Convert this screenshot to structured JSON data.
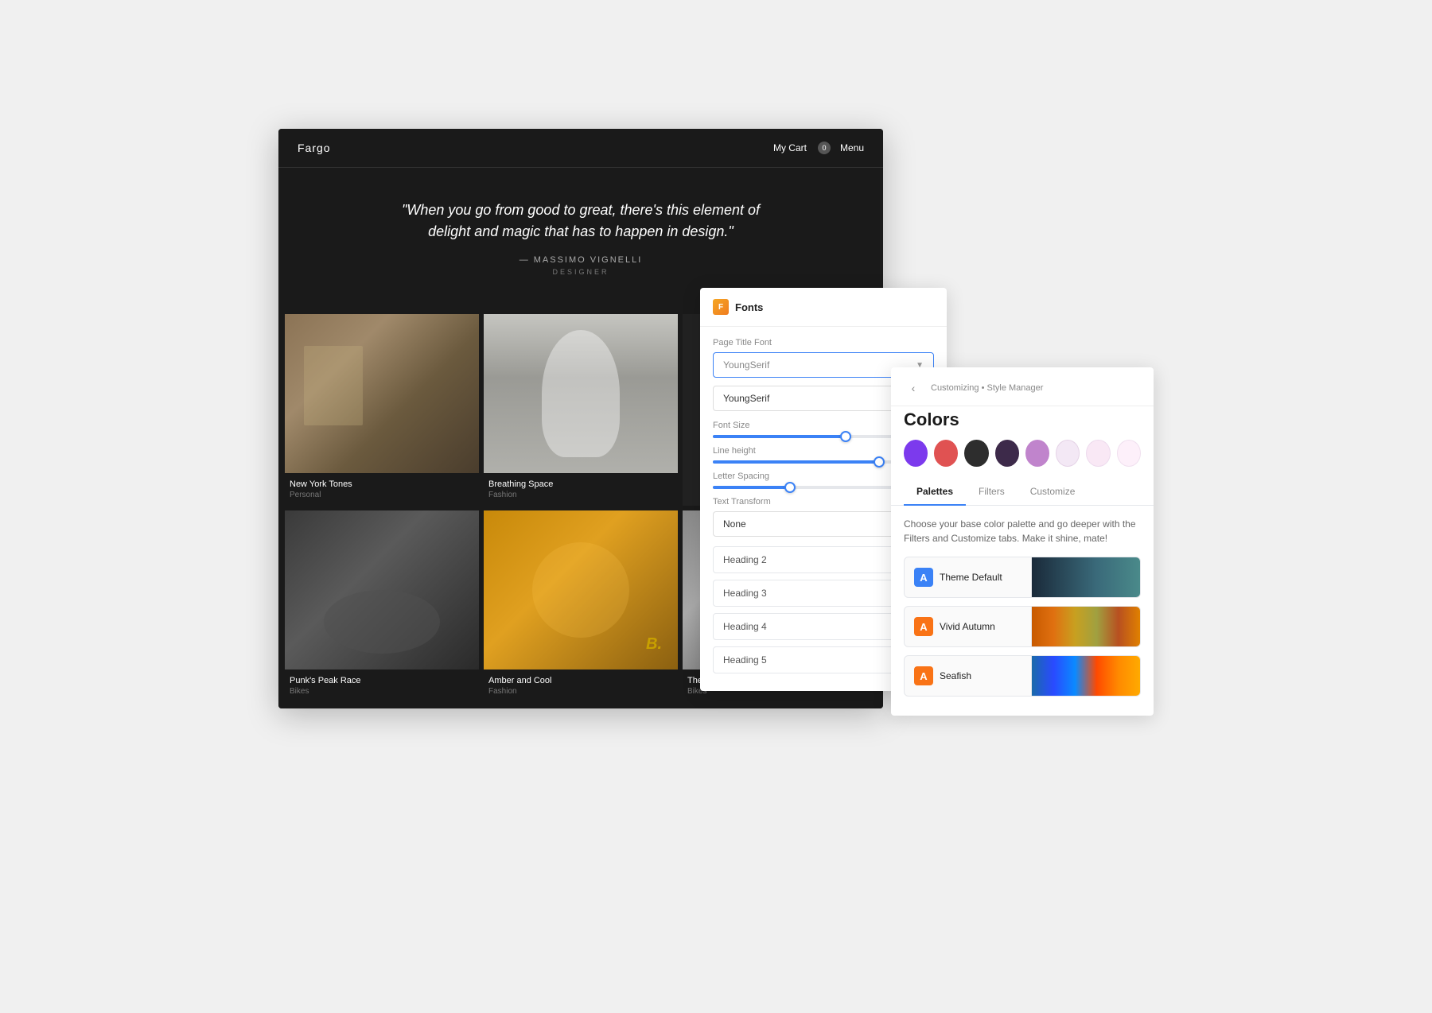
{
  "website": {
    "logo": "Fargo",
    "nav": {
      "cart_label": "My Cart",
      "cart_count": "0",
      "menu_label": "Menu"
    },
    "hero": {
      "quote": "\"When you go from good to great, there's this element of delight and magic that has to happen in design.\"",
      "author": "— MASSIMO VIGNELLI",
      "author_title": "DESIGNER"
    },
    "grid_items": [
      {
        "title": "New York Tones",
        "category": "Personal"
      },
      {
        "title": "Breathing Space",
        "category": "Fashion"
      },
      {
        "title": "Punk's Peak Race",
        "category": "Bikes"
      },
      {
        "title": "Amber and Cool",
        "category": "Fashion"
      },
      {
        "title": "The Bike Shed",
        "category": "Bikes"
      }
    ]
  },
  "fonts_panel": {
    "title": "Fonts",
    "icon_label": "F",
    "page_title_font_label": "Page Title Font",
    "page_title_font_value": "YoungSerif",
    "body_font_value": "YoungSerif",
    "font_size_label": "Font Size",
    "font_size_fill_pct": "60",
    "font_size_thumb_pct": "60",
    "line_height_label": "Line height",
    "line_height_fill_pct": "75",
    "line_height_thumb_pct": "75",
    "letter_spacing_label": "Letter Spacing",
    "letter_spacing_fill_pct": "35",
    "letter_spacing_thumb_pct": "35",
    "text_transform_label": "Text Transform",
    "text_transform_value": "None",
    "heading2_label": "Heading 2",
    "heading3_label": "Heading 3",
    "heading4_label": "Heading 4",
    "heading5_label": "Heading 5"
  },
  "colors_panel": {
    "breadcrumb": "Customizing • Style Manager",
    "title": "Colors",
    "back_label": "‹",
    "tabs": [
      "Palettes",
      "Filters",
      "Customize"
    ],
    "active_tab": "Palettes",
    "description": "Choose your base color palette and go deeper with the Filters and Customize tabs. Make it shine, mate!",
    "palettes": [
      {
        "name": "Theme Default",
        "icon_label": "A",
        "icon_class": "palette-icon-blue",
        "preview_class": "palette-preview-default"
      },
      {
        "name": "Vivid Autumn",
        "icon_label": "A",
        "icon_class": "palette-icon-orange",
        "preview_class": "palette-preview-autumn"
      },
      {
        "name": "Seafish",
        "icon_label": "A",
        "icon_class": "palette-icon-orange",
        "preview_class": "palette-preview-seafish"
      }
    ],
    "swatches": [
      {
        "class": "swatch-purple",
        "label": "purple"
      },
      {
        "class": "swatch-red",
        "label": "red"
      },
      {
        "class": "swatch-dark1",
        "label": "dark1"
      },
      {
        "class": "swatch-dark2",
        "label": "dark2"
      },
      {
        "class": "swatch-mauve",
        "label": "mauve"
      },
      {
        "class": "swatch-pink-light",
        "label": "pink-light"
      },
      {
        "class": "swatch-pink-lighter",
        "label": "pink-lighter"
      },
      {
        "class": "swatch-pink-lightest",
        "label": "pink-lightest"
      }
    ]
  }
}
